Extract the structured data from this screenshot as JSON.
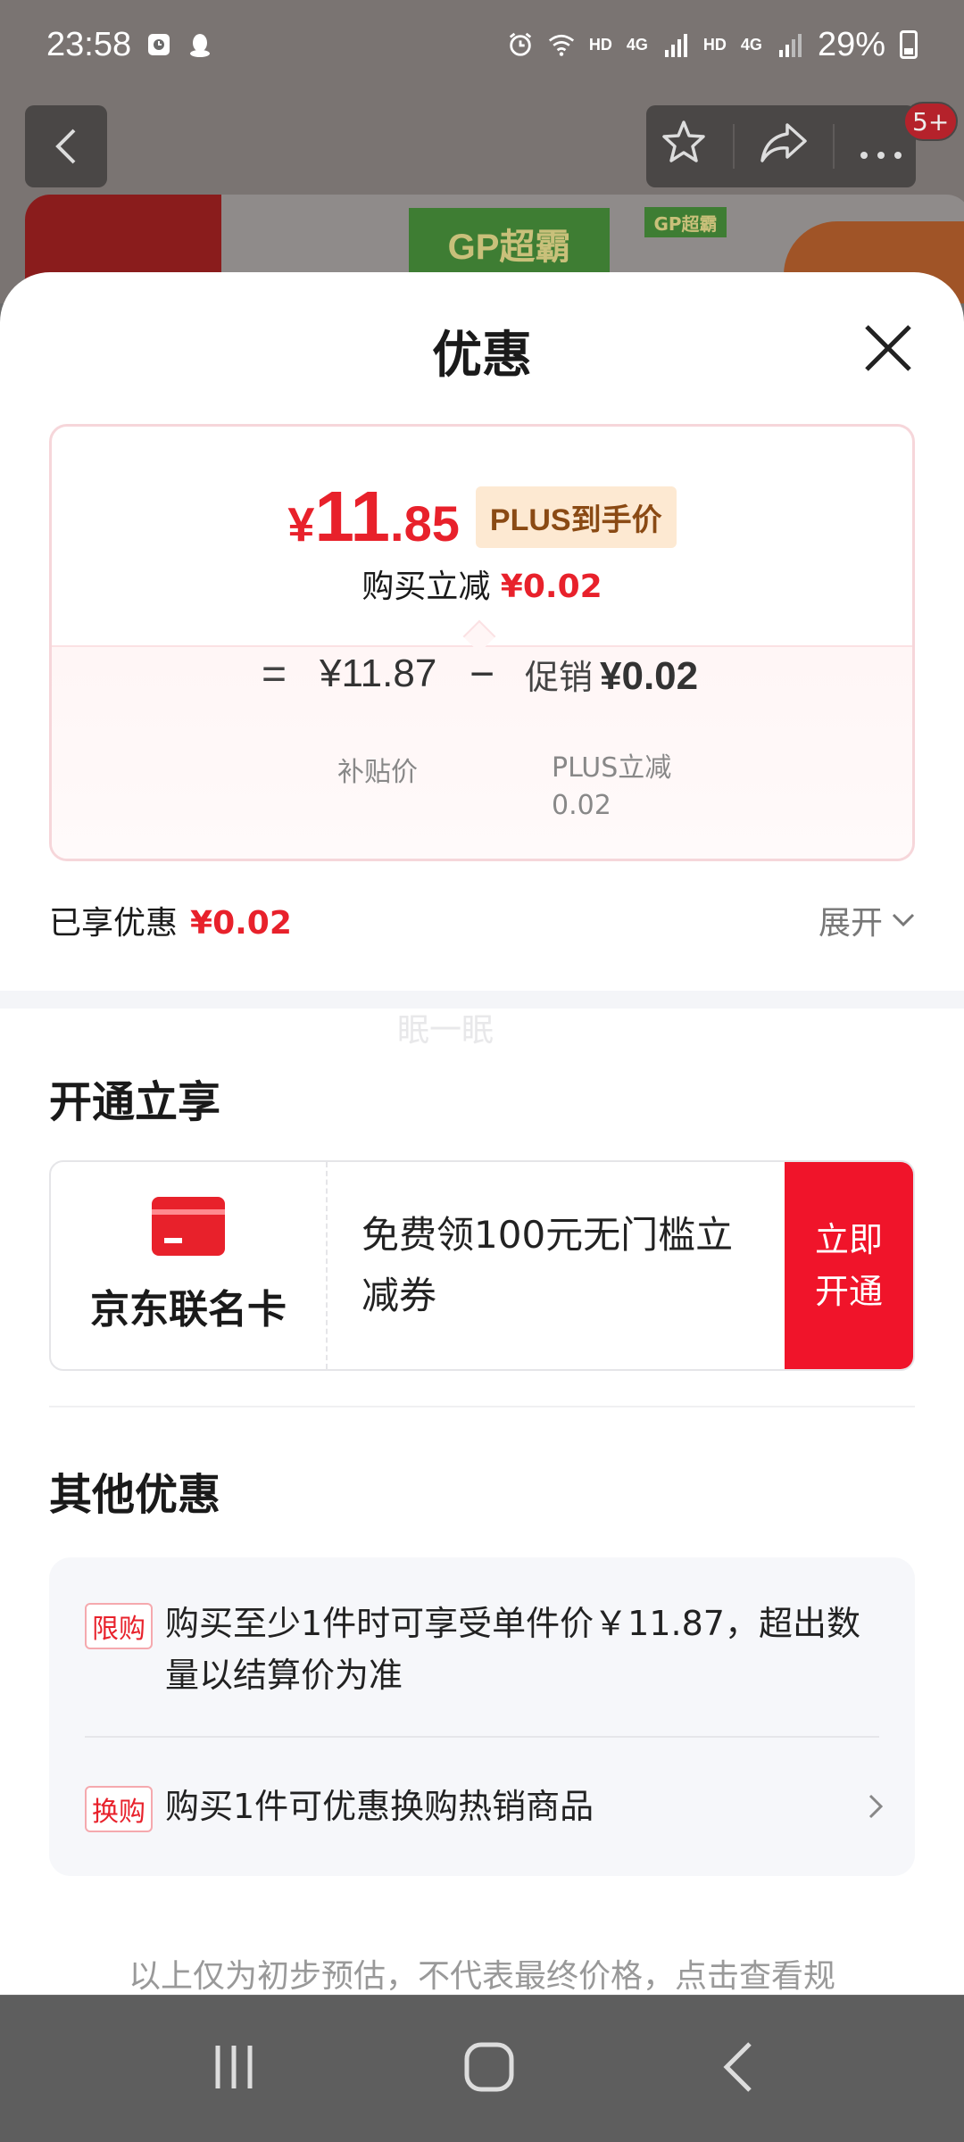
{
  "status_bar": {
    "time": "23:58",
    "net_hd1": "HD",
    "net_4g1": "4G",
    "net_hd2": "HD",
    "net_4g2": "4G",
    "battery": "29%"
  },
  "background": {
    "brand_text": "GP超霸",
    "brand_small": "GP超霸",
    "cart_badge": "5+"
  },
  "sheet": {
    "title": "优惠",
    "price_card": {
      "currency": "¥",
      "price_int": "11",
      "price_dec": ".85",
      "plus_tag": "PLUS到手价",
      "reduce_label": "购买立减",
      "reduce_value": "¥0.02",
      "equals": "=",
      "subsidy_price": "¥11.87",
      "minus": "−",
      "promo_label": "促销",
      "promo_value": "¥0.02",
      "subsidy_label": "补贴价",
      "plus_reduce_label": "PLUS立减",
      "plus_reduce_value": "0.02"
    },
    "enjoyed": {
      "label": "已享优惠",
      "value": "¥0.02",
      "expand": "展开"
    },
    "watermark": "眠一眠",
    "open_section": {
      "title": "开通立享",
      "card_name": "京东联名卡",
      "card_desc": "免费领100元无门槛立减券",
      "card_button": "立即开通"
    },
    "other_section": {
      "title": "其他优惠",
      "offers": [
        {
          "tag": "限购",
          "text": "购买至少1件时可享受单件价￥11.87，超出数量以结算价为准"
        },
        {
          "tag": "换购",
          "text": "购买1件可优惠换购热销商品"
        }
      ]
    },
    "footer_note": "以上仅为初步预估，不代表最终价格，点击查看规"
  },
  "colors": {
    "accent_red": "#e8212b",
    "button_red": "#f0142a",
    "plus_tag_bg": "#fde9d2"
  }
}
